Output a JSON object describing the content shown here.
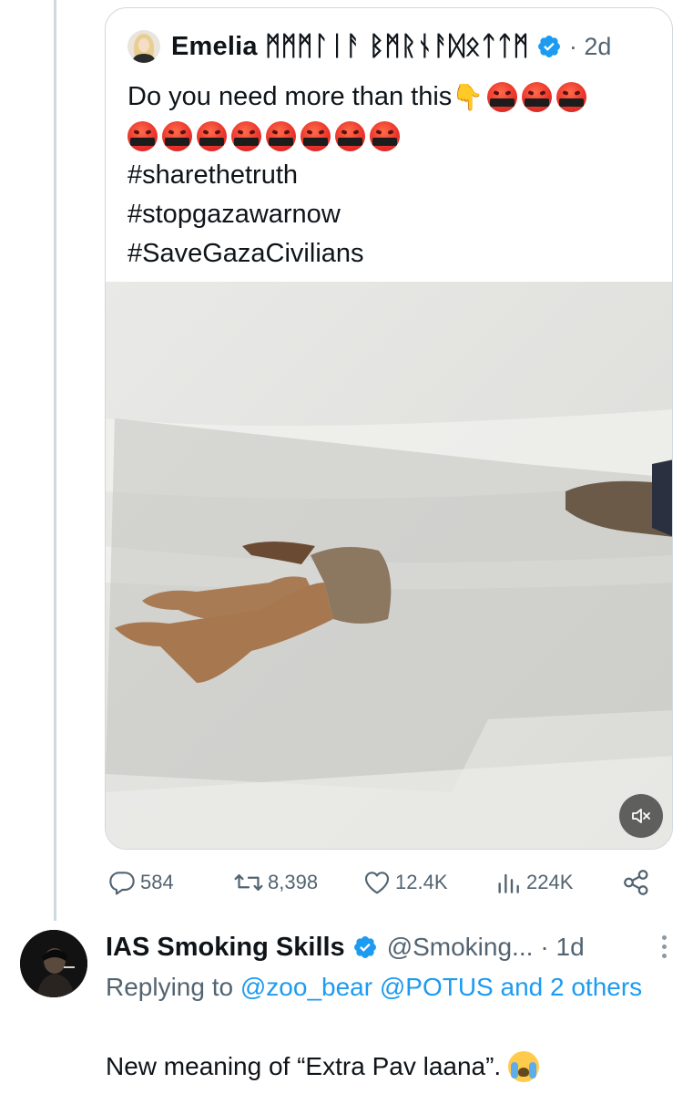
{
  "quoted_post": {
    "author_name": "Emelia ᛗᛗᛗᛚᛁᚨ ᛒᛗᚱᚾᚨᛞᛟᛏᛏᛗ",
    "timestamp": "· 2d",
    "text_line1": "Do you need more than this",
    "hashtag_1": "#sharethetruth",
    "hashtag_2": "#stopgazawarnow",
    "hashtag_3": "#SaveGazaCivilians",
    "rage_emoji_count_line1": 3,
    "rage_emoji_count_line2": 8,
    "media_type": "video",
    "mute_icon": "speaker-muted-icon"
  },
  "actions": {
    "replies": "584",
    "reposts": "8,398",
    "likes": "12.4K",
    "views": "224K"
  },
  "reply_post": {
    "author_name": "IAS Smoking Skills",
    "handle": "@Smoking...",
    "timestamp": "· 1d",
    "replying_prefix": "Replying to ",
    "mention_1": "@zoo_bear",
    "mention_2": "@POTUS",
    "mention_others": "and 2 others",
    "text": "New meaning of “Extra Pav laana”."
  },
  "colors": {
    "text_primary": "#0f1419",
    "text_secondary": "#536471",
    "accent": "#1d9bf0",
    "border": "#cfd9de"
  }
}
